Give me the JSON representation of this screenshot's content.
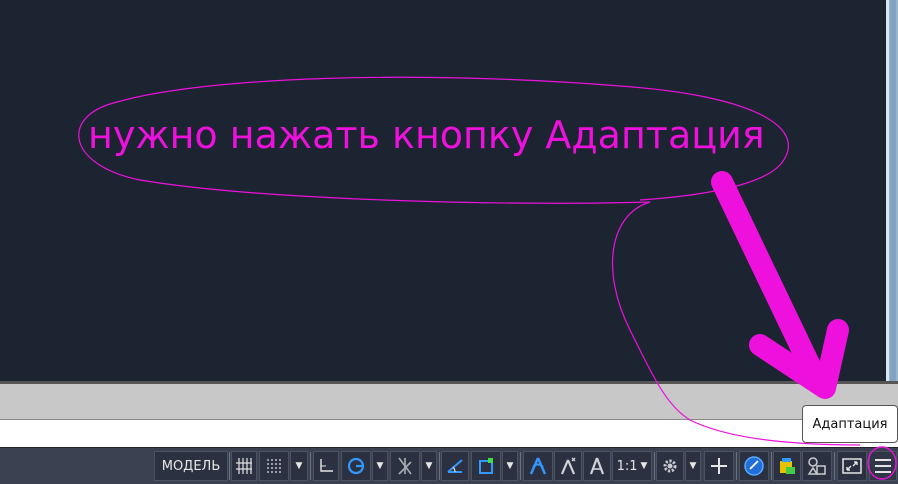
{
  "annotation": {
    "text": "нужно нажать кнопку Адаптация"
  },
  "statusbar": {
    "model_label": "МОДЕЛЬ",
    "scale_label": "1:1"
  },
  "tooltip": {
    "text": "Адаптация"
  },
  "colors": {
    "viewport_bg": "#1b2430",
    "annotation": "#ee11dd",
    "statusbar_bg": "#3a4150",
    "accent_blue": "#3399ff"
  }
}
